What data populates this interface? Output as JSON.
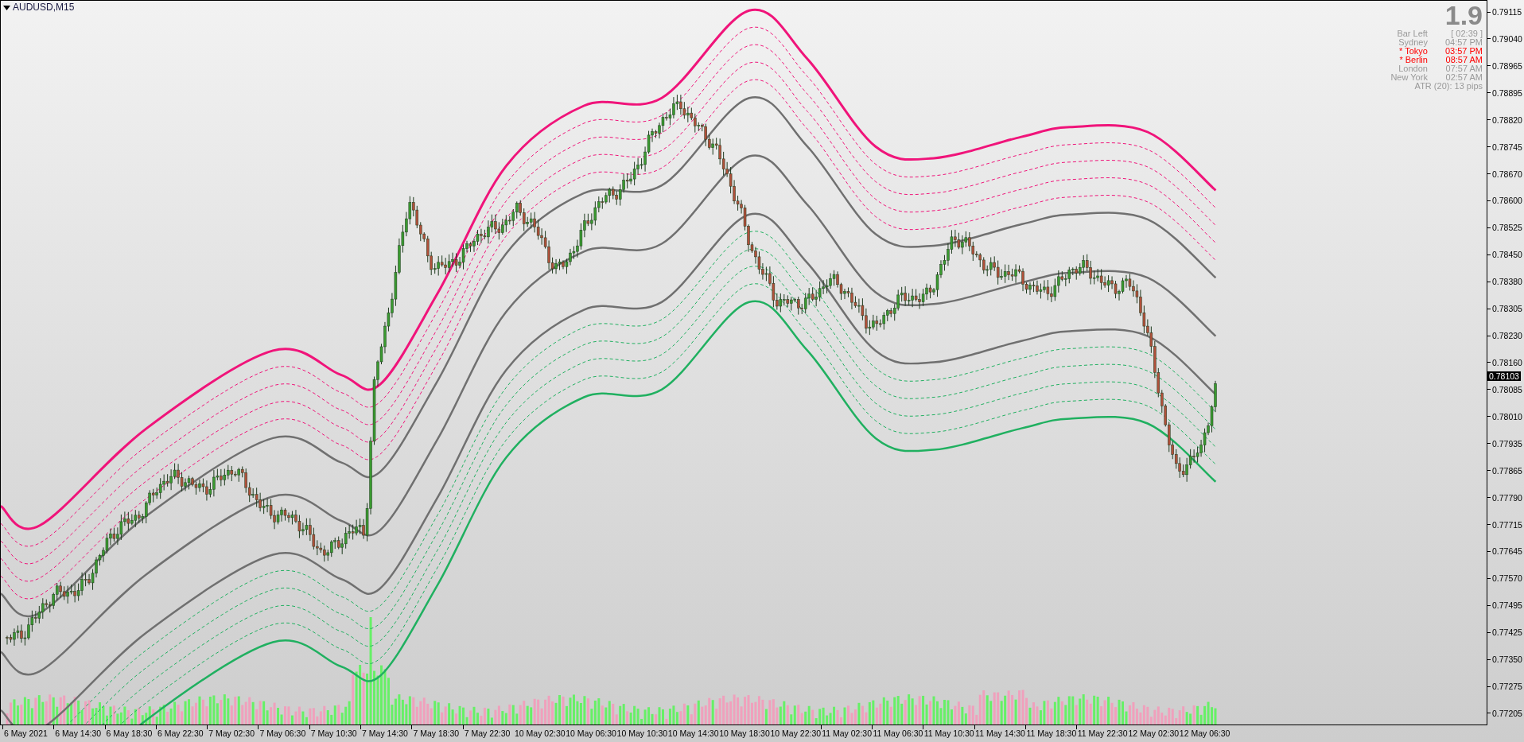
{
  "chart": {
    "symbol": "AUDUSD,M15",
    "info_panel": {
      "headline": "1.9",
      "rows": [
        {
          "label": "Bar Left",
          "value": "[ 02:39 ]",
          "highlighted": false
        },
        {
          "label": "Sydney",
          "value": "04:57 PM",
          "highlighted": false
        },
        {
          "label": "* Tokyo",
          "value": "03:57 PM",
          "highlighted": true
        },
        {
          "label": "* Berlin",
          "value": "08:57 AM",
          "highlighted": true
        },
        {
          "label": "London",
          "value": "07:57 AM",
          "highlighted": false
        },
        {
          "label": "New York",
          "value": "02:57 AM",
          "highlighted": false
        }
      ],
      "footer": "ATR (20): 13 pips"
    }
  },
  "price_axis": {
    "labels": [
      "0.79115",
      "0.79040",
      "0.78965",
      "0.78895",
      "0.78820",
      "0.78745",
      "0.78670",
      "0.78600",
      "0.78525",
      "0.78450",
      "0.78380",
      "0.78305",
      "0.78230",
      "0.78160",
      "0.78085",
      "0.78010",
      "0.77935",
      "0.77865",
      "0.77790",
      "0.77715",
      "0.77645",
      "0.77570",
      "0.77495",
      "0.77425",
      "0.77350",
      "0.77275",
      "0.77205"
    ],
    "current_price": "0.78103"
  },
  "time_axis": {
    "labels": [
      "6 May 2021",
      "6 May 14:30",
      "6 May 18:30",
      "6 May 22:30",
      "7 May 02:30",
      "7 May 06:30",
      "7 May 10:30",
      "7 May 14:30",
      "7 May 18:30",
      "7 May 22:30",
      "10 May 02:30",
      "10 May 06:30",
      "10 May 10:30",
      "10 May 14:30",
      "10 May 18:30",
      "10 May 22:30",
      "11 May 02:30",
      "11 May 06:30",
      "11 May 10:30",
      "11 May 14:30",
      "11 May 18:30",
      "11 May 22:30",
      "12 May 02:30",
      "12 May 06:30"
    ]
  }
}
